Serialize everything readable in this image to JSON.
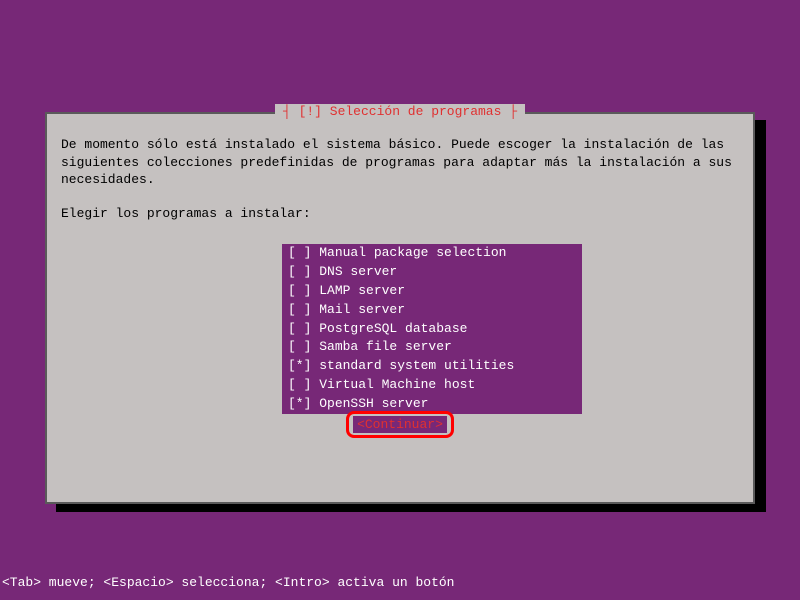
{
  "title_prefix": "┤ ",
  "title": "[!] Selección de programas",
  "title_suffix": " ├",
  "description": "De momento sólo está instalado el sistema básico. Puede escoger la instalación de las siguientes colecciones predefinidas de programas para adaptar más la instalación a sus necesidades.",
  "prompt": "Elegir los programas a instalar:",
  "items": [
    {
      "checkbox": "[ ]",
      "label": "Manual package selection"
    },
    {
      "checkbox": "[ ]",
      "label": "DNS server"
    },
    {
      "checkbox": "[ ]",
      "label": "LAMP server"
    },
    {
      "checkbox": "[ ]",
      "label": "Mail server"
    },
    {
      "checkbox": "[ ]",
      "label": "PostgreSQL database"
    },
    {
      "checkbox": "[ ]",
      "label": "Samba file server"
    },
    {
      "checkbox": "[*]",
      "label": "standard system utilities"
    },
    {
      "checkbox": "[ ]",
      "label": "Virtual Machine host"
    },
    {
      "checkbox": "[*]",
      "label": "OpenSSH server"
    }
  ],
  "continue_label": "<Continuar>",
  "footer": "<Tab> mueve; <Espacio> selecciona; <Intro> activa un botón"
}
